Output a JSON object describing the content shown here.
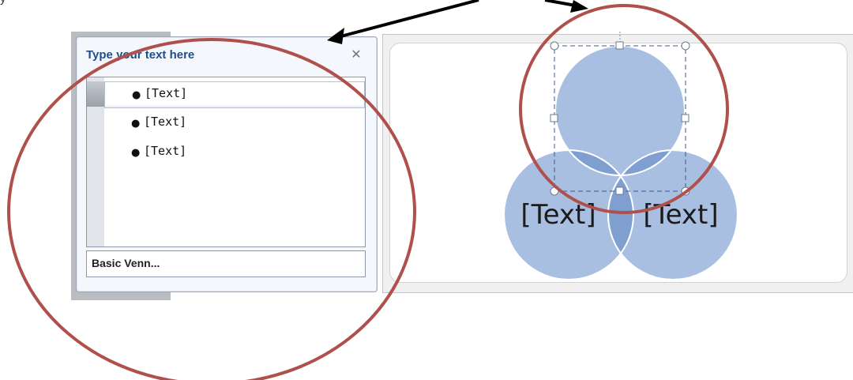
{
  "caption": "y",
  "text_pane": {
    "title": "Type your text here",
    "close_icon": "✕",
    "items": [
      {
        "label": "[Text]"
      },
      {
        "label": "[Text]"
      },
      {
        "label": "[Text]"
      }
    ],
    "layout_name": "Basic Venn..."
  },
  "venn": {
    "circles": [
      {
        "label": ""
      },
      {
        "label": "[Text]"
      },
      {
        "label": "[Text]"
      }
    ]
  },
  "colors": {
    "pane_title": "#1e4e8c",
    "circle_fill": "#9fb7db",
    "annotation": "#b0504c",
    "arrow": "#000000"
  }
}
